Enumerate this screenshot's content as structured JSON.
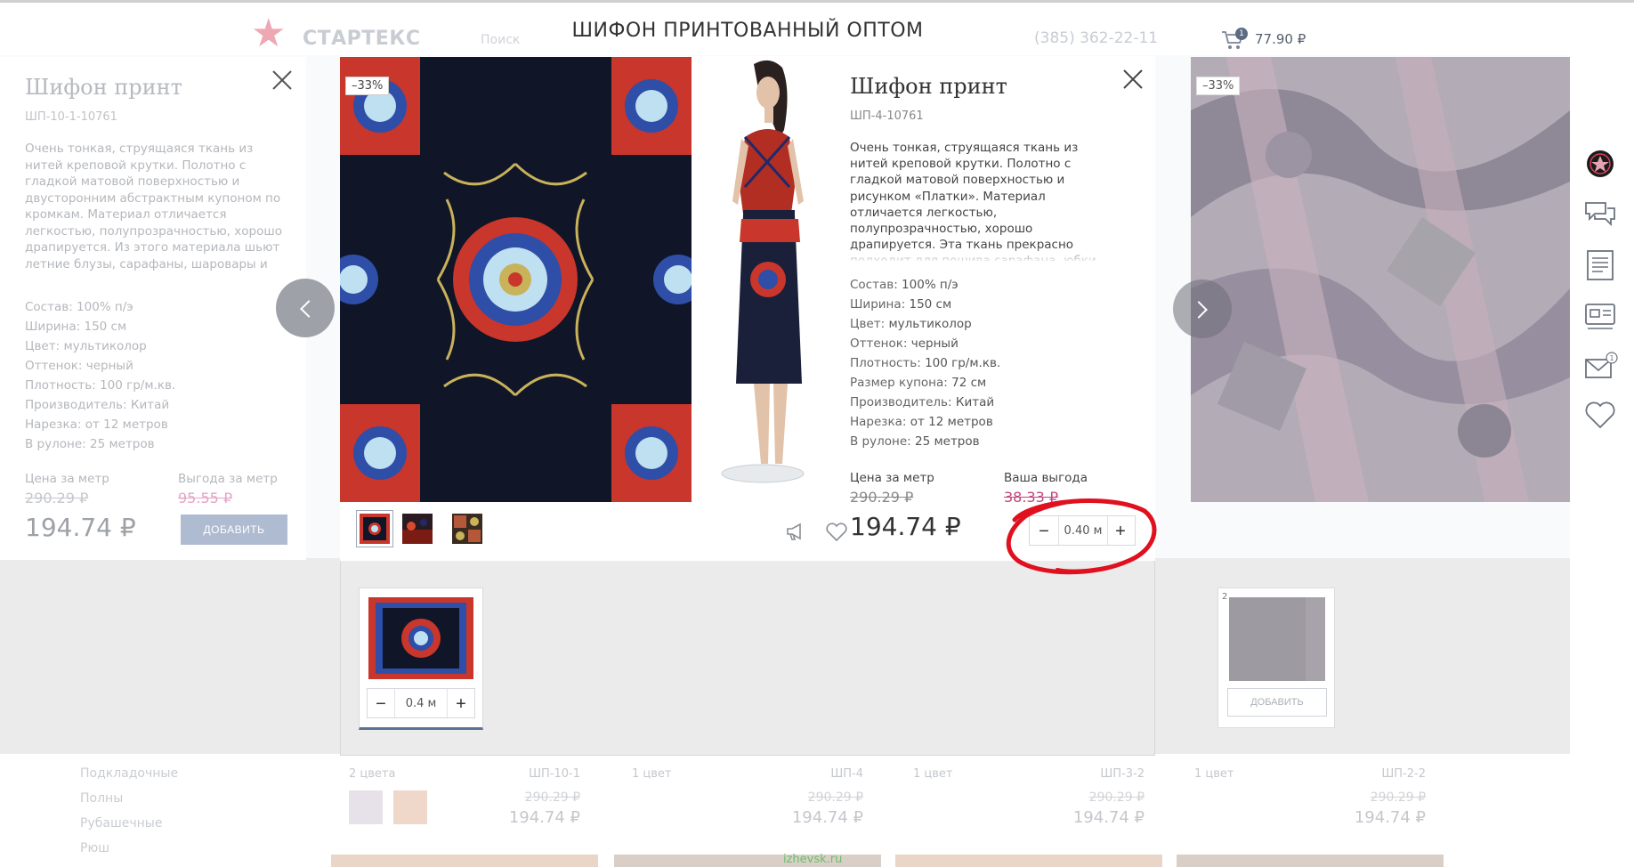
{
  "header": {
    "logo_text": "СТАРТЕКС",
    "phone": "(385) 362-22-11",
    "search_placeholder": "Поиск",
    "cart_count": "1",
    "cart_total": "77.90 ₽"
  },
  "page_title": "ШИФОН ПРИНТОВАННЫЙ ОПТОМ",
  "left_product": {
    "title": "Шифон принт",
    "sku": "ШП-10-1-10761",
    "description": "Очень тонкая, струящаяся ткань из нитей креповой крутки. Полотно с гладкой матовой поверхностью и двусторонним абстрактным купоном по кромкам. Материал отличается легкостью, полупрозрачностью, хорошо драпируется. Из этого материала шьют летние блузы, сарафаны, шаровары и легкие летящие юбки. Одежда из этой ткани красива и",
    "specs": [
      {
        "k": "Состав:",
        "v": "100% п/э"
      },
      {
        "k": "Ширина:",
        "v": "150 см"
      },
      {
        "k": "Цвет:",
        "v": "мультиколор"
      },
      {
        "k": "Оттенок:",
        "v": "черный"
      },
      {
        "k": "Плотность:",
        "v": "100 гр/м.кв."
      },
      {
        "k": "Производитель:",
        "v": "Китай"
      },
      {
        "k": "Нарезка:",
        "v": "от 12 метров"
      },
      {
        "k": "В рулоне:",
        "v": "25 метров"
      }
    ],
    "price_label": "Цена за метр",
    "benefit_label": "Выгода за метр",
    "old_price": "290.29 ₽",
    "benefit_value": "95.55 ₽",
    "price": "194.74 ₽",
    "add_label": "ДОБАВИТЬ"
  },
  "main_product": {
    "discount": "–33%",
    "title": "Шифон принт",
    "sku": "ШП-4-10761",
    "description": "Очень тонкая, струящаяся ткань из нитей креповой крутки. Полотно с гладкой матовой поверхностью и рисунком «Платки». Материал отличается легкостью, полупрозрачностью, хорошо драпируется. Эта ткань прекрасно подходит для пошива сарафана, юбки или легкого, воздушного платка.",
    "specs": [
      {
        "k": "Состав:",
        "v": "100% п/э"
      },
      {
        "k": "Ширина:",
        "v": "150 см"
      },
      {
        "k": "Цвет:",
        "v": "мультиколор"
      },
      {
        "k": "Оттенок:",
        "v": "черный"
      },
      {
        "k": "Плотность:",
        "v": "100 гр/м.кв."
      },
      {
        "k": "Размер купона:",
        "v": "72 см"
      },
      {
        "k": "Производитель:",
        "v": "Китай"
      },
      {
        "k": "Нарезка:",
        "v": "от 12 метров"
      },
      {
        "k": "В рулоне:",
        "v": "25 метров"
      }
    ],
    "price_label": "Цена за метр",
    "benefit_label": "Ваша выгода",
    "old_price": "290.29 ₽",
    "benefit_value": "38.33 ₽",
    "price": "194.74 ₽",
    "quantity": "0.40 м",
    "minus": "−",
    "plus": "+"
  },
  "selection": {
    "quantity": "0.4 м",
    "minus": "−",
    "plus": "+"
  },
  "right_product": {
    "discount": "–33%",
    "count": "2",
    "add_label": "ДОБАВИТЬ"
  },
  "bg_menu": [
    "Подкладочные",
    "Полны",
    "Рубашечные",
    "Рюш"
  ],
  "bg_cards": [
    {
      "colors": "2 цвета",
      "art": "ШП-10-1",
      "old": "290.29 ₽",
      "price": "194.74 ₽"
    },
    {
      "colors": "1 цвет",
      "art": "ШП-4",
      "old": "290.29 ₽",
      "price": "194.74 ₽"
    },
    {
      "colors": "1 цвет",
      "art": "ШП-3-2",
      "old": "290.29 ₽",
      "price": "194.74 ₽"
    },
    {
      "colors": "1 цвет",
      "art": "ШП-2-2",
      "old": "290.29 ₽",
      "price": "194.74 ₽"
    }
  ],
  "watermark": "izhevsk.ru",
  "colors": {
    "accent": "#5c7293",
    "benefit": "#c2457d",
    "annotation": "#e0101e",
    "add_button": "#aebbd0"
  }
}
